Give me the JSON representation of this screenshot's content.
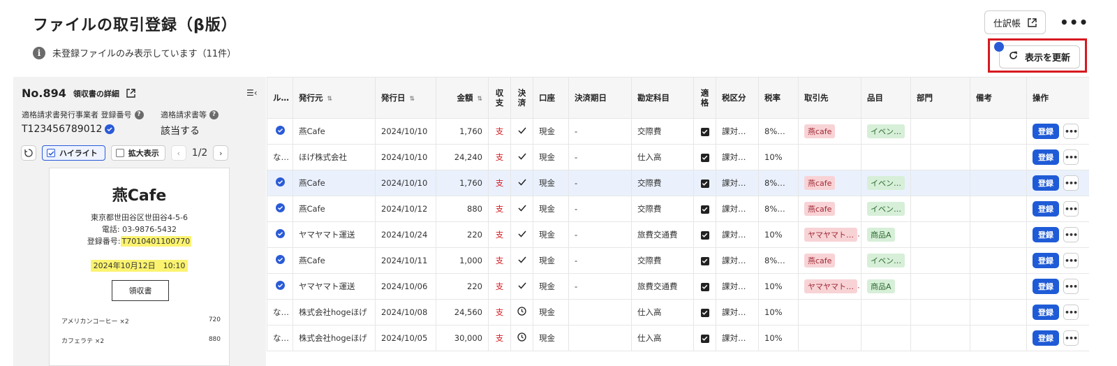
{
  "page": {
    "title": "ファイルの取引登録（β版）",
    "notice": "未登録ファイルのみ表示しています（11件）"
  },
  "header": {
    "journal_label": "仕訳帳",
    "more_label": "•••",
    "refresh_label": "表示を更新"
  },
  "left_panel": {
    "number": "No.894",
    "detail_label": "領収書の詳細",
    "collapse_glyph": "☰‹",
    "reg_label": "適格請求書発行事業者 登録番号",
    "reg_value": "T123456789012",
    "qual_label": "適格請求書等",
    "qual_value": "該当する",
    "highlight_label": "ハイライト",
    "zoom_label": "拡大表示",
    "page_indicator": "1/2",
    "receipt": {
      "shop": "燕Cafe",
      "address": "東京都世田谷区世田谷4-5-6",
      "phone": "電話: 03-9876-5432",
      "reg_prefix": "登録番号:",
      "reg_number": "T7010401100770",
      "datetime": "2024年10月12日　10:10",
      "doc_title": "領収書",
      "items": [
        {
          "name": "アメリカンコーヒー ×2",
          "price": "720"
        },
        {
          "name": "カフェラテ ×2",
          "price": "880"
        }
      ]
    }
  },
  "table": {
    "headers": {
      "rule": "ル…",
      "issuer": "発行元",
      "date": "発行日",
      "amount": "金額",
      "type_a": "収",
      "type_b": "支",
      "settle_a": "決",
      "settle_b": "済",
      "account": "口座",
      "due": "決済期日",
      "subject": "勘定科目",
      "qual_a": "適",
      "qual_b": "格",
      "tax_cat": "税区分",
      "tax_rate": "税率",
      "partner": "取引先",
      "item": "品目",
      "dept": "部門",
      "memo": "備考",
      "ops": "操作"
    },
    "register_label": "登録",
    "more_label": "•••",
    "rows": [
      {
        "rule": "check",
        "issuer": "燕Cafe",
        "date": "2024/10/10",
        "amount": "1,760",
        "type": "支",
        "settled": "check",
        "account": "現金",
        "due": "-",
        "subject": "交際費",
        "qualified": true,
        "tax_cat": "課対仕…",
        "tax_rate": "8%（…",
        "partner": "燕cafe",
        "item": "イベン…",
        "dept": "",
        "memo": "",
        "selected": false
      },
      {
        "rule": "なし",
        "issuer": "ほげ株式会社",
        "date": "2024/10/10",
        "amount": "24,240",
        "type": "支",
        "settled": "check",
        "account": "現金",
        "due": "-",
        "subject": "仕入高",
        "qualified": true,
        "tax_cat": "課対仕…",
        "tax_rate": "10%",
        "partner": "",
        "item": "",
        "dept": "",
        "memo": "",
        "selected": false
      },
      {
        "rule": "check",
        "issuer": "燕Cafe",
        "date": "2024/10/10",
        "amount": "1,760",
        "type": "支",
        "settled": "check",
        "account": "現金",
        "due": "-",
        "subject": "交際費",
        "qualified": true,
        "tax_cat": "課対仕…",
        "tax_rate": "8%（…",
        "partner": "燕cafe",
        "item": "イベン…",
        "dept": "",
        "memo": "",
        "selected": true
      },
      {
        "rule": "check",
        "issuer": "燕Cafe",
        "date": "2024/10/12",
        "amount": "880",
        "type": "支",
        "settled": "check",
        "account": "現金",
        "due": "-",
        "subject": "交際費",
        "qualified": true,
        "tax_cat": "課対仕…",
        "tax_rate": "8%（…",
        "partner": "燕cafe",
        "item": "イベン…",
        "dept": "",
        "memo": "",
        "selected": false
      },
      {
        "rule": "check",
        "issuer": "ヤマヤマト運送",
        "date": "2024/10/24",
        "amount": "220",
        "type": "支",
        "settled": "check",
        "account": "現金",
        "due": "-",
        "subject": "旅費交通費",
        "qualified": true,
        "tax_cat": "課対仕…",
        "tax_rate": "10%",
        "partner": "ヤマヤマト…",
        "item": "商品A",
        "dept": "",
        "memo": "",
        "selected": false
      },
      {
        "rule": "check",
        "issuer": "燕Cafe",
        "date": "2024/10/11",
        "amount": "1,000",
        "type": "支",
        "settled": "check",
        "account": "現金",
        "due": "-",
        "subject": "交際費",
        "qualified": true,
        "tax_cat": "課対仕…",
        "tax_rate": "8%（…",
        "partner": "燕cafe",
        "item": "イベン…",
        "dept": "",
        "memo": "",
        "selected": false
      },
      {
        "rule": "check",
        "issuer": "ヤマヤマト運送",
        "date": "2024/10/06",
        "amount": "220",
        "type": "支",
        "settled": "check",
        "account": "現金",
        "due": "-",
        "subject": "旅費交通費",
        "qualified": true,
        "tax_cat": "課対仕…",
        "tax_rate": "10%",
        "partner": "ヤマヤマト…",
        "item": "商品A",
        "dept": "",
        "memo": "",
        "selected": false
      },
      {
        "rule": "なし",
        "issuer": "株式会社hogeほげ",
        "date": "2024/10/08",
        "amount": "24,560",
        "type": "支",
        "settled": "clock",
        "account": "現金",
        "due": "",
        "subject": "仕入高",
        "qualified": true,
        "tax_cat": "課対仕…",
        "tax_rate": "10%",
        "partner": "",
        "item": "",
        "dept": "",
        "memo": "",
        "selected": false
      },
      {
        "rule": "なし",
        "issuer": "株式会社hogeほげ",
        "date": "2024/10/05",
        "amount": "30,000",
        "type": "支",
        "settled": "clock",
        "account": "現金",
        "due": "",
        "subject": "仕入高",
        "qualified": true,
        "tax_cat": "課対仕…",
        "tax_rate": "10%",
        "partner": "",
        "item": "",
        "dept": "",
        "memo": "",
        "selected": false
      }
    ]
  },
  "colors": {
    "accent": "#1f5bd7",
    "expense": "#d71920",
    "highlight_frame": "#d71920",
    "selected_row": "#eaf1fd"
  }
}
